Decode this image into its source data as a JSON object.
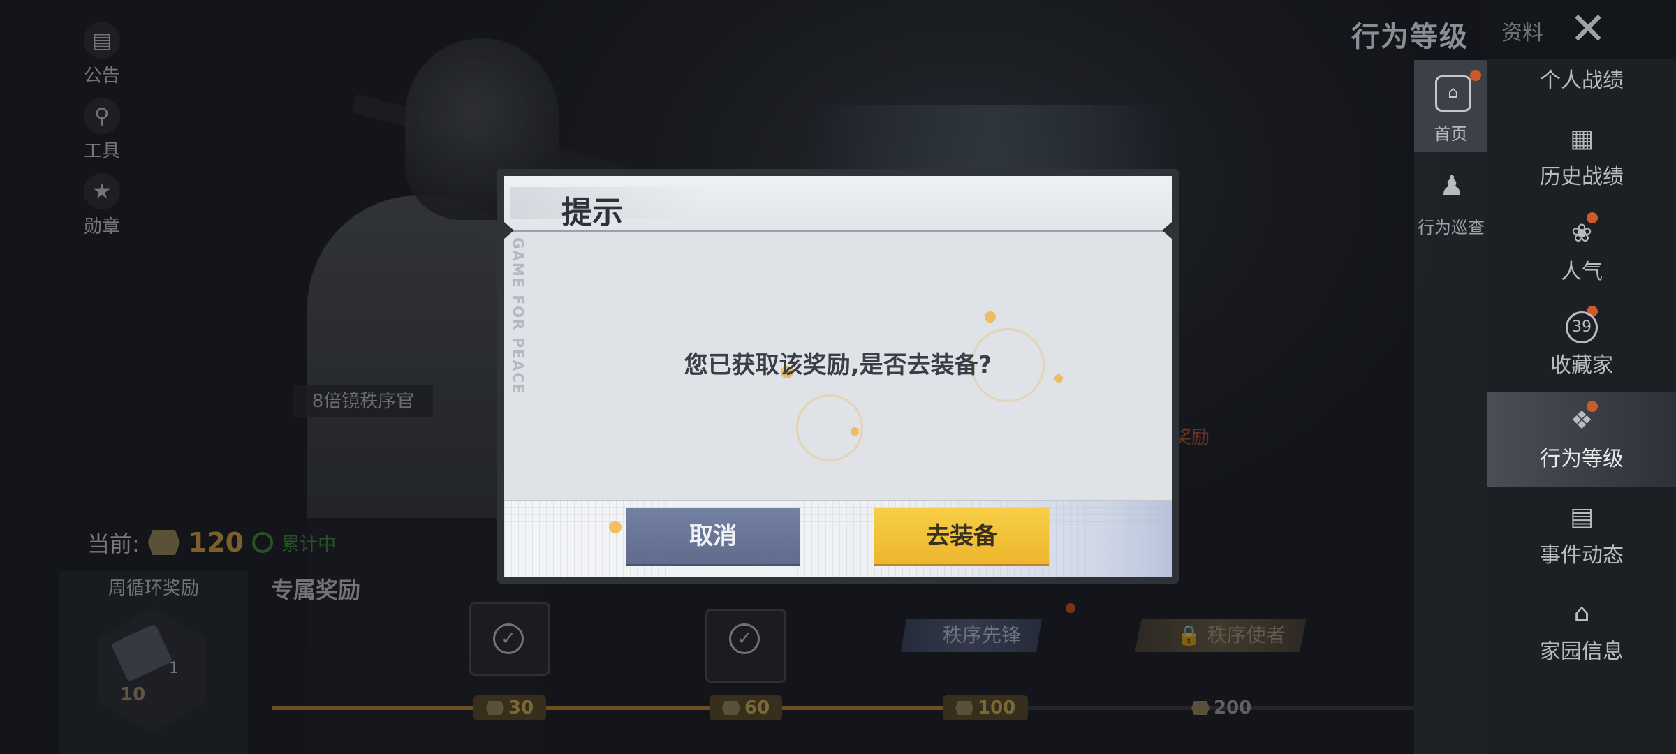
{
  "left_nav": [
    {
      "label": "公告",
      "icon": "notice-icon"
    },
    {
      "label": "工具",
      "icon": "tool-icon"
    },
    {
      "label": "勋章",
      "icon": "medal-icon"
    }
  ],
  "character_title": "8倍镜秩序官",
  "current": {
    "label": "当前:",
    "points": "120",
    "status": "累计中"
  },
  "weekly_reward": {
    "label": "周循环奖励",
    "item_count": "1",
    "cost": "10"
  },
  "exclusive_reward": {
    "label": "专属奖励",
    "milestones": [
      "30",
      "60",
      "100",
      "200"
    ],
    "badges": [
      "秩序先锋",
      "秩序使者"
    ]
  },
  "background_fragment": "奖励",
  "top_title": "行为等级",
  "profile_tab": "资料",
  "side_tabs": [
    {
      "label": "首页",
      "icon": "home-icon"
    },
    {
      "label": "行为巡查",
      "icon": "patrol-icon"
    }
  ],
  "right_menu": [
    {
      "label": "个人战绩",
      "icon": "stats-icon",
      "dot": true
    },
    {
      "label": "历史战绩",
      "icon": "history-icon",
      "dot": false
    },
    {
      "label": "人气",
      "icon": "popularity-icon",
      "dot": true
    },
    {
      "label": "收藏家",
      "icon": "collector-icon",
      "dot": true,
      "badge": "39"
    },
    {
      "label": "行为等级",
      "icon": "behavior-level-icon",
      "dot": true,
      "active": true
    },
    {
      "label": "事件动态",
      "icon": "event-icon",
      "dot": false
    },
    {
      "label": "家园信息",
      "icon": "homeland-icon",
      "dot": false
    }
  ],
  "dialog": {
    "title": "提示",
    "watermark": "GAME FOR PEACE",
    "message": "您已获取该奖励,是否去装备?",
    "cancel_label": "取消",
    "confirm_label": "去装备"
  },
  "colors": {
    "accent_gold": "#edb52d",
    "cancel_blue": "#6a7597",
    "progress_gold": "#b98a2c",
    "status_green": "#3f8d3c",
    "notification_red": "#cc5a2a"
  }
}
